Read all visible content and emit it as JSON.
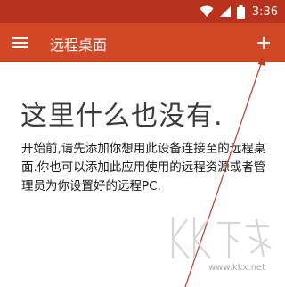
{
  "status_bar": {
    "time": "3:36",
    "icons": [
      "wifi-icon",
      "signal-icon",
      "battery-icon"
    ]
  },
  "app_bar": {
    "title": "远程桌面",
    "menu_icon": "hamburger-menu-icon",
    "add_icon": "plus-icon"
  },
  "empty_state": {
    "title": "这里什么也没有.",
    "description": "开始前,请先添加你想用此设备连接至的远程桌面.你也可以添加此应用使用的远程资源或者管理员为你设置好的远程PC."
  },
  "watermark": {
    "logo_text": "KK下载",
    "url": "www.kkx.net"
  },
  "colors": {
    "status_bar": "#b8321e",
    "app_bar": "#d24726",
    "annotation_arrow": "#c0392b",
    "title_text": "#3a3a3a",
    "body_text": "#1a1a1a"
  }
}
